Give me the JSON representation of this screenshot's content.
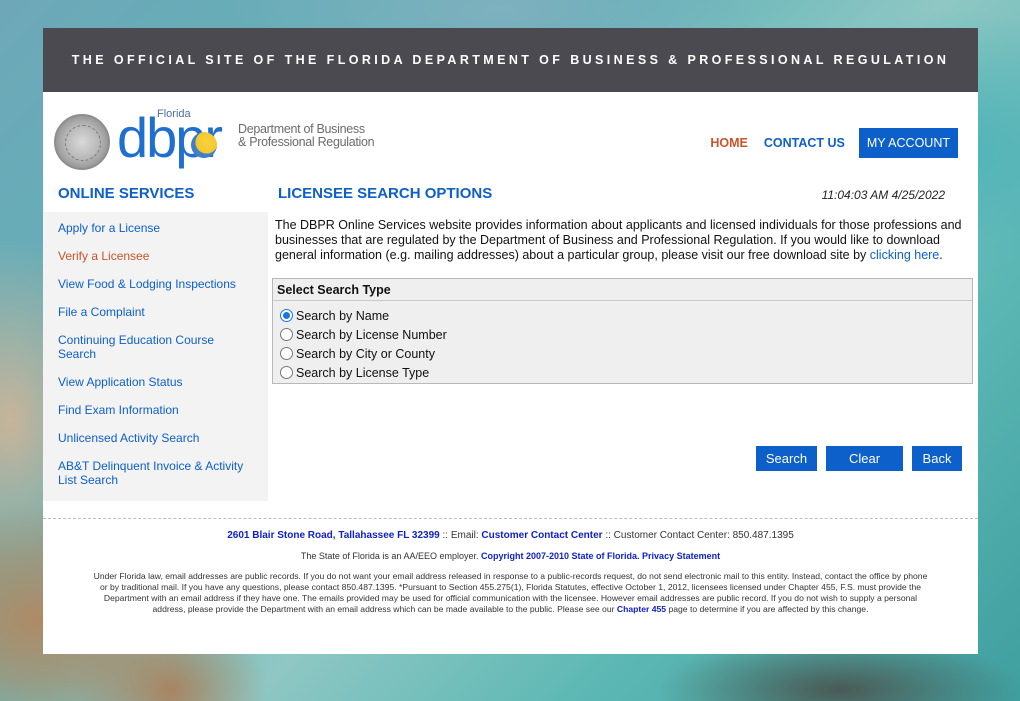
{
  "banner": {
    "text": "THE OFFICIAL SITE OF THE FLORIDA DEPARTMENT OF BUSINESS & PROFESSIONAL REGULATION"
  },
  "logo": {
    "florida": "Florida",
    "dbpr": "dbpr",
    "line1": "Department of Business",
    "line2": "& Professional Regulation"
  },
  "topnav": {
    "home": "HOME",
    "contact": "CONTACT US",
    "account": "MY ACCOUNT"
  },
  "sidebar": {
    "title": "ONLINE SERVICES",
    "items": [
      {
        "label": "Apply for a License",
        "active": false
      },
      {
        "label": "Verify a Licensee",
        "active": true
      },
      {
        "label": "View Food & Lodging Inspections",
        "active": false
      },
      {
        "label": "File a Complaint",
        "active": false
      },
      {
        "label": "Continuing Education Course Search",
        "active": false
      },
      {
        "label": "View Application Status",
        "active": false
      },
      {
        "label": "Find Exam Information",
        "active": false
      },
      {
        "label": "Unlicensed Activity Search",
        "active": false
      },
      {
        "label": "AB&T Delinquent Invoice & Activity List Search",
        "active": false
      }
    ]
  },
  "main": {
    "title": "LICENSEE SEARCH OPTIONS",
    "timestamp": "11:04:03 AM 4/25/2022",
    "intro": "The DBPR Online Services website provides information about applicants and licensed individuals for those professions and businesses that are regulated by the Department of Business and Professional Regulation. If you would like to download general information (e.g. mailing addresses) about a particular group, please visit our free download site by ",
    "intro_link": "clicking here",
    "intro_end": ".",
    "search_box": {
      "heading": "Select Search Type",
      "options": [
        {
          "label": "Search by Name",
          "checked": true
        },
        {
          "label": "Search by License Number",
          "checked": false
        },
        {
          "label": "Search by City or County",
          "checked": false
        },
        {
          "label": "Search by License Type",
          "checked": false
        }
      ]
    },
    "buttons": {
      "search": "Search",
      "clear": "Clear",
      "back": "Back"
    }
  },
  "footer": {
    "address": "2601 Blair Stone Road, Tallahassee FL 32399",
    "sep1": " :: Email: ",
    "email_link": "Customer Contact Center",
    "sep2": " :: Customer Contact Center: 850.487.1395",
    "eeo": "The State of Florida is an AA/EEO employer. ",
    "copyright": "Copyright 2007-2010 State of Florida.",
    "privacy": "Privacy Statement",
    "legal": "Under Florida law, email addresses are public records. If you do not want your email address released in response to a public-records request, do not send electronic mail to this entity. Instead, contact the office by phone or by traditional mail. If you have any questions, please contact 850.487.1395. *Pursuant to Section 455.275(1), Florida Statutes, effective October 1, 2012, licensees licensed under Chapter 455, F.S. must provide the Department with an email address if they have one. The emails provided may be used for official communication with the licensee. However email addresses are public record. If you do not wish to supply a personal address, please provide the Department with an email address which can be made available to the public. Please see our ",
    "legal_link": "Chapter 455",
    "legal_end": " page to determine if you are affected by this change."
  }
}
